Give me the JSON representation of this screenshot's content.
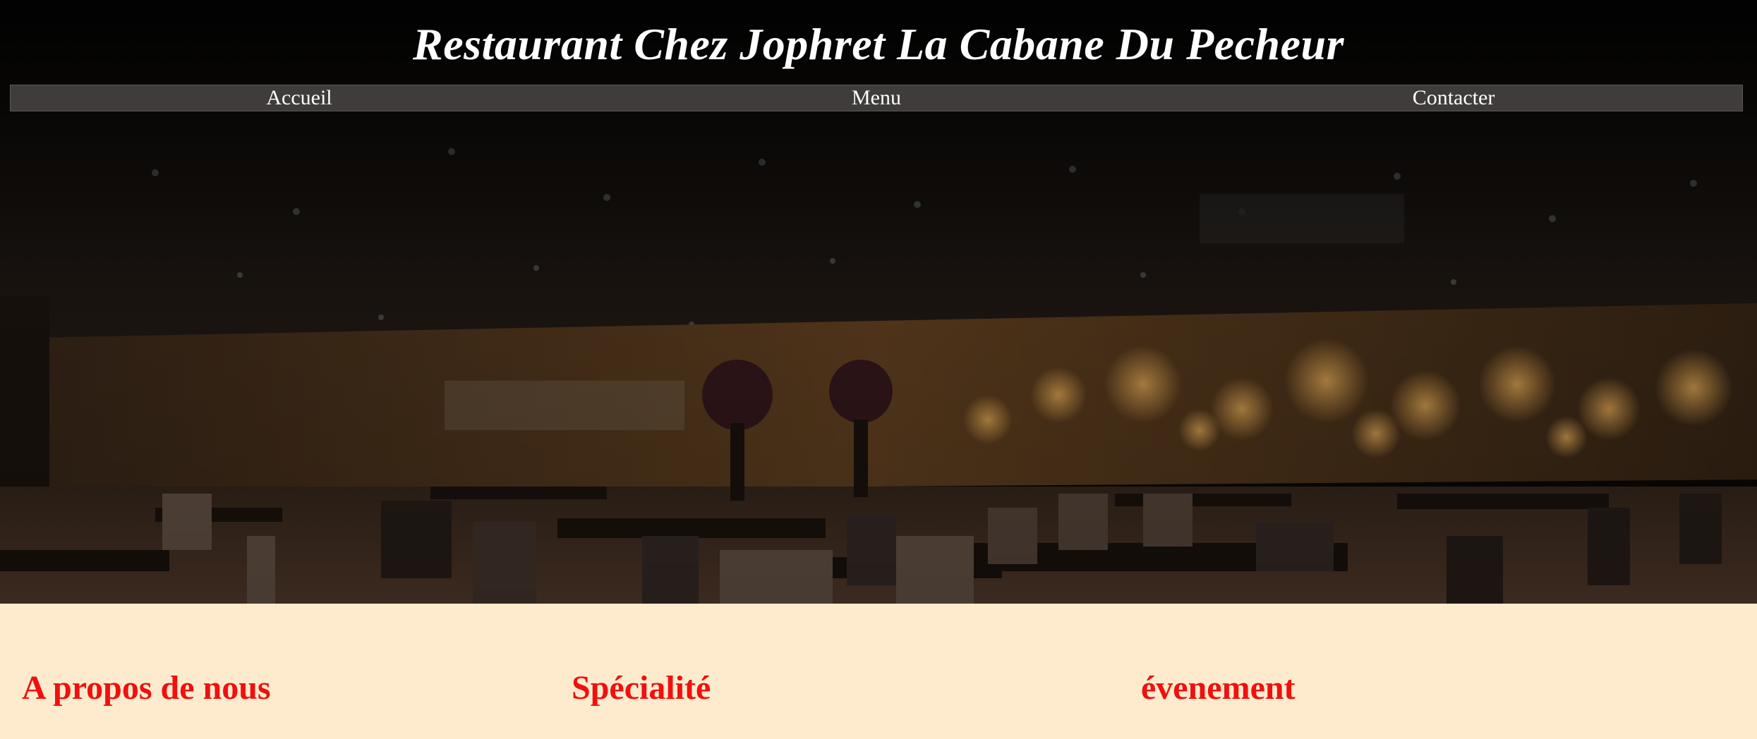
{
  "header": {
    "title": "Restaurant Chez Jophret La Cabane Du Pecheur"
  },
  "nav": {
    "items": [
      {
        "label": "Accueil"
      },
      {
        "label": "Menu"
      },
      {
        "label": "Contacter"
      }
    ]
  },
  "hero": {
    "image": "restaurant-dining-room-photo"
  },
  "sections": [
    {
      "heading": "A propos de nous"
    },
    {
      "heading": "Spécialité"
    },
    {
      "heading": "évenement"
    }
  ],
  "colors": {
    "accent_heading": "#f01010",
    "section_background": "#feebcd",
    "nav_background": "#3f3c3b",
    "title_color": "#ffffff"
  }
}
